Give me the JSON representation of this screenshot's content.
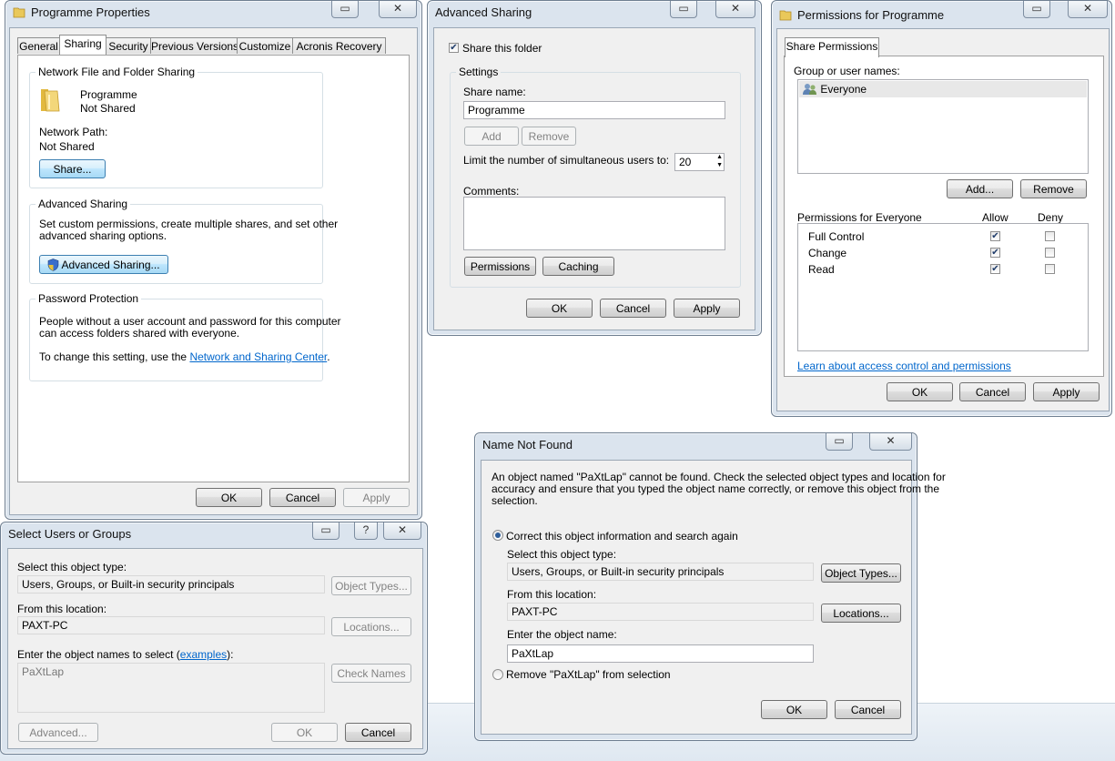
{
  "colors": {
    "accent": "#3c7fb1",
    "link": "#0066cc",
    "window_frame": "#dbe4ee"
  },
  "window_buttons": {
    "restore": "▭",
    "close": "✕",
    "help": "?"
  },
  "programme_properties": {
    "title": "Programme Properties",
    "tabs": [
      "General",
      "Sharing",
      "Security",
      "Previous Versions",
      "Customize",
      "Acronis Recovery"
    ],
    "network_group": "Network File and Folder Sharing",
    "folder_name": "Programme",
    "folder_status": "Not Shared",
    "network_path_label": "Network Path:",
    "network_path_value": "Not Shared",
    "share_button": "Share...",
    "advanced_group": "Advanced Sharing",
    "advanced_desc_1": "Set custom permissions, create multiple shares, and set other",
    "advanced_desc_2": "advanced sharing options.",
    "advanced_button": "Advanced Sharing...",
    "password_group": "Password Protection",
    "password_desc_1": "People without a user account and password for this computer",
    "password_desc_2": "can access folders shared with everyone.",
    "password_change_prefix": "To change this setting, use the",
    "password_link": "Network and Sharing Center",
    "password_suffix": ".",
    "ok": "OK",
    "cancel": "Cancel",
    "apply": "Apply"
  },
  "advanced_sharing": {
    "title": "Advanced Sharing",
    "share_checkbox": "Share this folder",
    "settings_group": "Settings",
    "share_name_label": "Share name:",
    "share_name_value": "Programme",
    "add": "Add",
    "remove": "Remove",
    "limit_label": "Limit the number of simultaneous users to:",
    "limit_value": "20",
    "comments_label": "Comments:",
    "permissions": "Permissions",
    "caching": "Caching",
    "ok": "OK",
    "cancel": "Cancel",
    "apply": "Apply"
  },
  "permissions": {
    "title": "Permissions for Programme",
    "tab": "Share Permissions",
    "group_label": "Group or user names:",
    "users": [
      "Everyone"
    ],
    "add": "Add...",
    "remove": "Remove",
    "perm_label": "Permissions for Everyone",
    "allow": "Allow",
    "deny": "Deny",
    "rows": [
      {
        "name": "Full Control",
        "allow": true,
        "deny": false
      },
      {
        "name": "Change",
        "allow": true,
        "deny": false
      },
      {
        "name": "Read",
        "allow": true,
        "deny": false
      }
    ],
    "learn_link": "Learn about access control and permissions",
    "ok": "OK",
    "cancel": "Cancel",
    "apply": "Apply"
  },
  "select_users": {
    "title": "Select Users or Groups",
    "object_type_label": "Select this object type:",
    "object_type_value": "Users, Groups, or Built-in security principals",
    "object_types_btn": "Object Types...",
    "location_label": "From this location:",
    "location_value": "PAXT-PC",
    "locations_btn": "Locations...",
    "enter_label_prefix": "Enter the object names to select (",
    "examples_link": "examples",
    "enter_label_suffix": "):",
    "names_value": "PaXtLap",
    "check_names": "Check Names",
    "advanced": "Advanced...",
    "ok": "OK",
    "cancel": "Cancel"
  },
  "name_not_found": {
    "title": "Name Not Found",
    "message_1": "An object named \"PaXtLap\" cannot be found. Check the selected object types and location for",
    "message_2": "accuracy and ensure that you typed the object name correctly, or remove this object from the",
    "message_3": "selection.",
    "correct_option": "Correct this object information and search again",
    "object_type_label": "Select this object type:",
    "object_type_value": "Users, Groups, or Built-in security principals",
    "object_types_btn": "Object Types...",
    "location_label": "From this location:",
    "location_value": "PAXT-PC",
    "locations_btn": "Locations...",
    "name_label": "Enter the object name:",
    "name_value": "PaXtLap",
    "remove_option": "Remove \"PaXtLap\" from selection",
    "ok": "OK",
    "cancel": "Cancel"
  }
}
